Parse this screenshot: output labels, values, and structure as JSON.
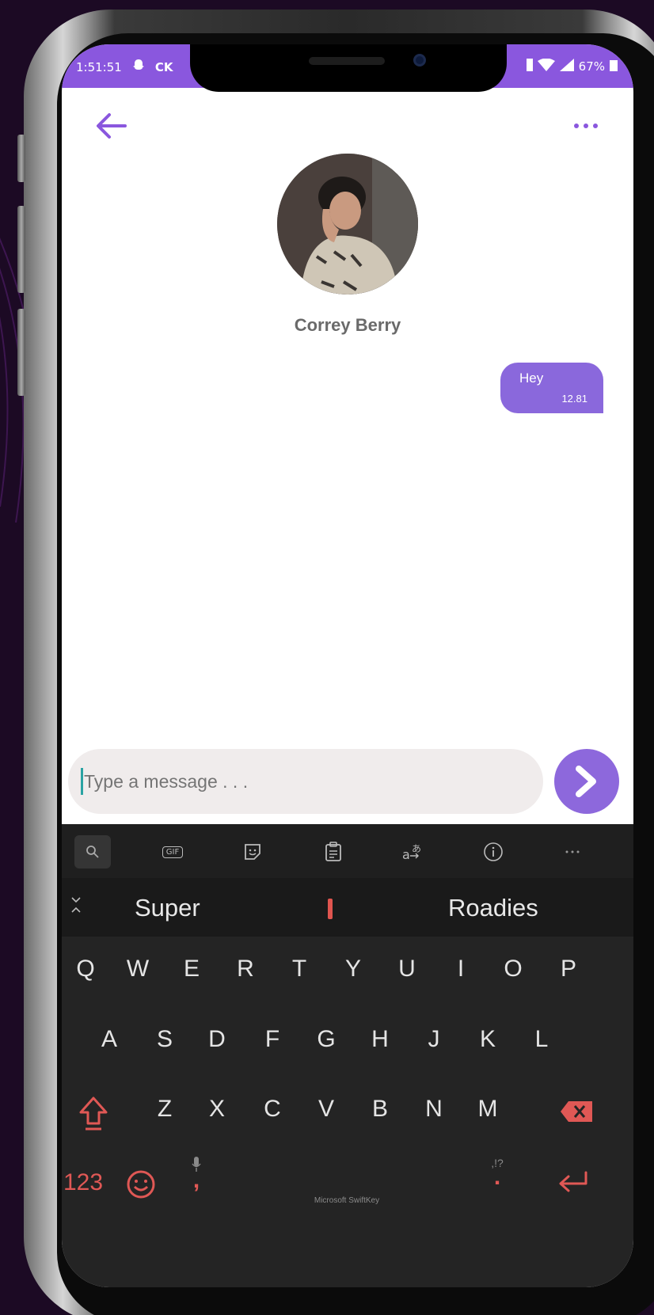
{
  "status_bar": {
    "time": "1:51:51",
    "carrier_label": "CK",
    "battery": "67%"
  },
  "header": {
    "back_icon": "arrow-left-icon",
    "more_icon": "more-horizontal-icon"
  },
  "contact": {
    "name": "Correy Berry"
  },
  "messages": [
    {
      "text": "Hey",
      "time": "12.81",
      "direction": "outgoing"
    }
  ],
  "composer": {
    "placeholder": "Type a message . . ."
  },
  "keyboard": {
    "toolbar": [
      "search-icon",
      "gif-icon",
      "sticker-icon",
      "clipboard-icon",
      "translate-icon",
      "info-icon",
      "more-icon"
    ],
    "gif_label": "GIF",
    "suggestions": [
      "Super",
      "Roadies"
    ],
    "rows": [
      [
        "Q",
        "W",
        "E",
        "R",
        "T",
        "Y",
        "U",
        "I",
        "O",
        "P"
      ],
      [
        "A",
        "S",
        "D",
        "F",
        "G",
        "H",
        "J",
        "K",
        "L"
      ],
      [
        "Z",
        "X",
        "C",
        "V",
        "B",
        "N",
        "M"
      ]
    ],
    "numbers_label": "123",
    "comma": ",",
    "period": ".",
    "punct_hint": ",!?",
    "brand": "Microsoft SwiftKey"
  },
  "colors": {
    "accent": "#8a57de",
    "bubble": "#8a68dc",
    "keyboard_bg": "#242424",
    "key_red": "#e05855"
  }
}
